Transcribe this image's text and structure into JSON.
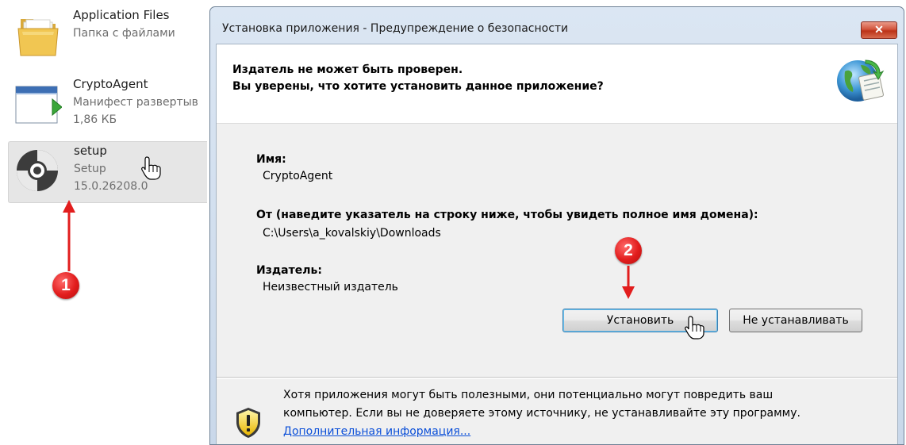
{
  "explorer": {
    "items": [
      {
        "name": "Application Files",
        "type": "Папка с файлами",
        "icon": "folder-icon"
      },
      {
        "name": "CryptoAgent",
        "type": "Манифест развертыв",
        "size": "1,86 КБ",
        "icon": "manifest-icon"
      },
      {
        "name": "setup",
        "type": "Setup",
        "version": "15.0.26208.0",
        "icon": "setup-disc-icon"
      }
    ]
  },
  "annotations": {
    "marker1": "1",
    "marker2": "2",
    "color": "#e21d1d"
  },
  "dialog": {
    "title": "Установка приложения - Предупреждение о безопасности",
    "close_label": "✕",
    "header_line1": "Издатель не может быть проверен.",
    "header_line2": "Вы уверены, что хотите установить данное приложение?",
    "name_label": "Имя:",
    "name_value": "CryptoAgent",
    "from_label": "От (наведите указатель на строку ниже, чтобы увидеть полное имя домена):",
    "from_value": "C:\\Users\\a_kovalskiy\\Downloads",
    "publisher_label": "Издатель:",
    "publisher_value": "Неизвестный издатель",
    "install_button": "Установить",
    "dont_install_button": "Не устанавливать",
    "warning_line1": "Хотя приложения могут быть полезными, они потенциально могут повредить ваш",
    "warning_line2": "компьютер. Если вы не доверяете этому источнику, не устанавливайте эту программу.",
    "more_info_link": "Дополнительная информация..."
  }
}
